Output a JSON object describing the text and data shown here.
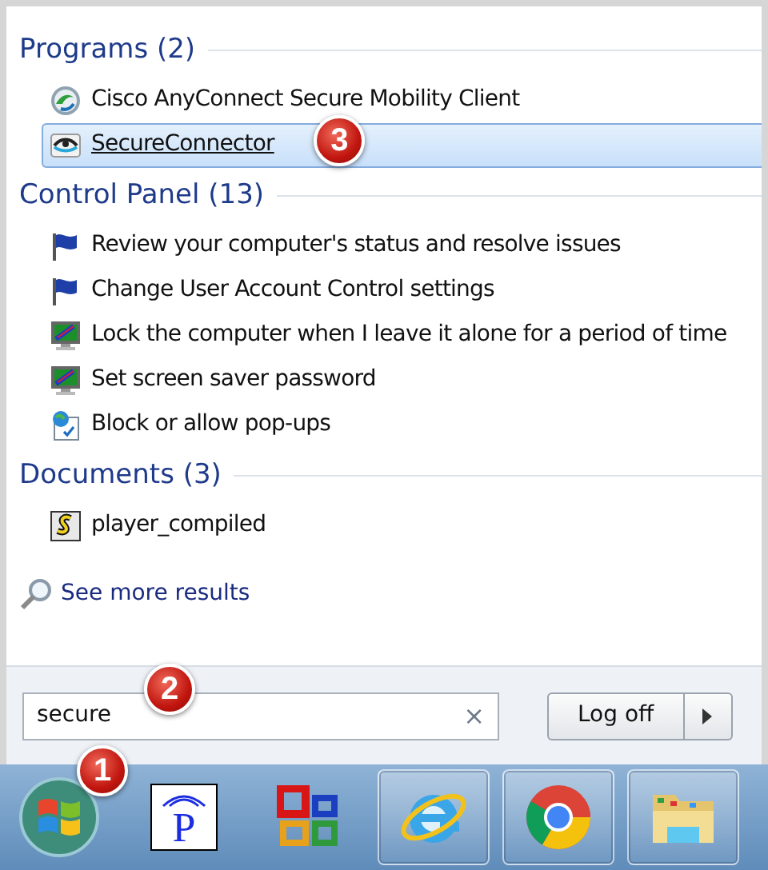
{
  "sections": [
    {
      "title": "Programs (2)",
      "items": [
        {
          "label": "Cisco AnyConnect Secure Mobility Client",
          "kind": "globe",
          "selected": false
        },
        {
          "label": "SecureConnector",
          "kind": "eye",
          "selected": true,
          "callout": "3"
        }
      ]
    },
    {
      "title": "Control Panel (13)",
      "items": [
        {
          "label": "Review your computer's status and resolve issues",
          "kind": "flag",
          "selected": false
        },
        {
          "label": "Change User Account Control settings",
          "kind": "flag",
          "selected": false
        },
        {
          "label": "Lock the computer when I leave it alone for a period of time",
          "kind": "monitor",
          "selected": false
        },
        {
          "label": "Set screen saver password",
          "kind": "monitor",
          "selected": false
        },
        {
          "label": "Block or allow pop-ups",
          "kind": "popup",
          "selected": false
        }
      ]
    },
    {
      "title": "Documents (3)",
      "items": [
        {
          "label": "player_compiled",
          "kind": "script",
          "selected": false
        }
      ]
    }
  ],
  "see_more": "See more results",
  "search": {
    "value": "secure",
    "clear": "×",
    "callout": "2"
  },
  "power_button": {
    "label": "Log off"
  },
  "taskbar": [
    {
      "kind": "start",
      "running": false,
      "callout": "1"
    },
    {
      "kind": "p-app",
      "label": "P",
      "running": false
    },
    {
      "kind": "office",
      "running": false
    },
    {
      "kind": "ie",
      "running": true
    },
    {
      "kind": "chrome",
      "running": true
    },
    {
      "kind": "explorer",
      "running": true
    }
  ]
}
